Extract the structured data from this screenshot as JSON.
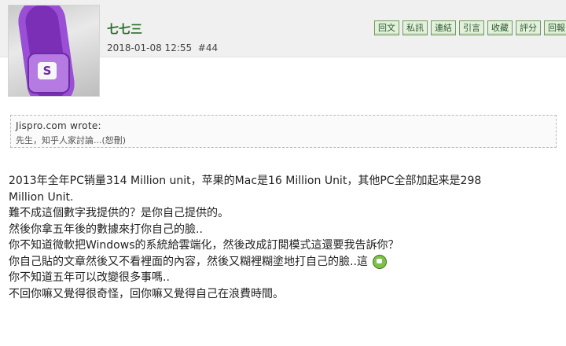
{
  "post": {
    "username": "七七三",
    "timestamp": "2018-01-08 12:55",
    "post_number": "#44"
  },
  "toolbar": {
    "buttons": [
      "回文",
      "私訊",
      "連結",
      "引言",
      "收藏",
      "評分",
      "回報"
    ]
  },
  "quote": {
    "author": "Jispro.com wrote:",
    "text": "先生，知乎人家討論...(恕刪)"
  },
  "content": {
    "lines": [
      "2013年全年PC销量314 Million unit，苹果的Mac是16 Million Unit，其他PC全部加起来是298",
      "Million Unit.",
      "難不成這個數字我提供的？是你自己提供的。",
      "然後你拿五年後的數據來打你自己的臉..",
      "你不知道微軟把Windows的系統給雲端化，然後改成訂閱模式這還要我告訴你？",
      "你自己貼的文章然後又不看裡面的內容，然後又糊裡糊塗地打自己的臉..這",
      "你不知道五年可以改變很多事嗎..",
      "不回你嘛又覺得很奇怪，回你嘛又覺得自己在浪費時間。"
    ],
    "emoji_icon": "laughing-face-icon"
  }
}
